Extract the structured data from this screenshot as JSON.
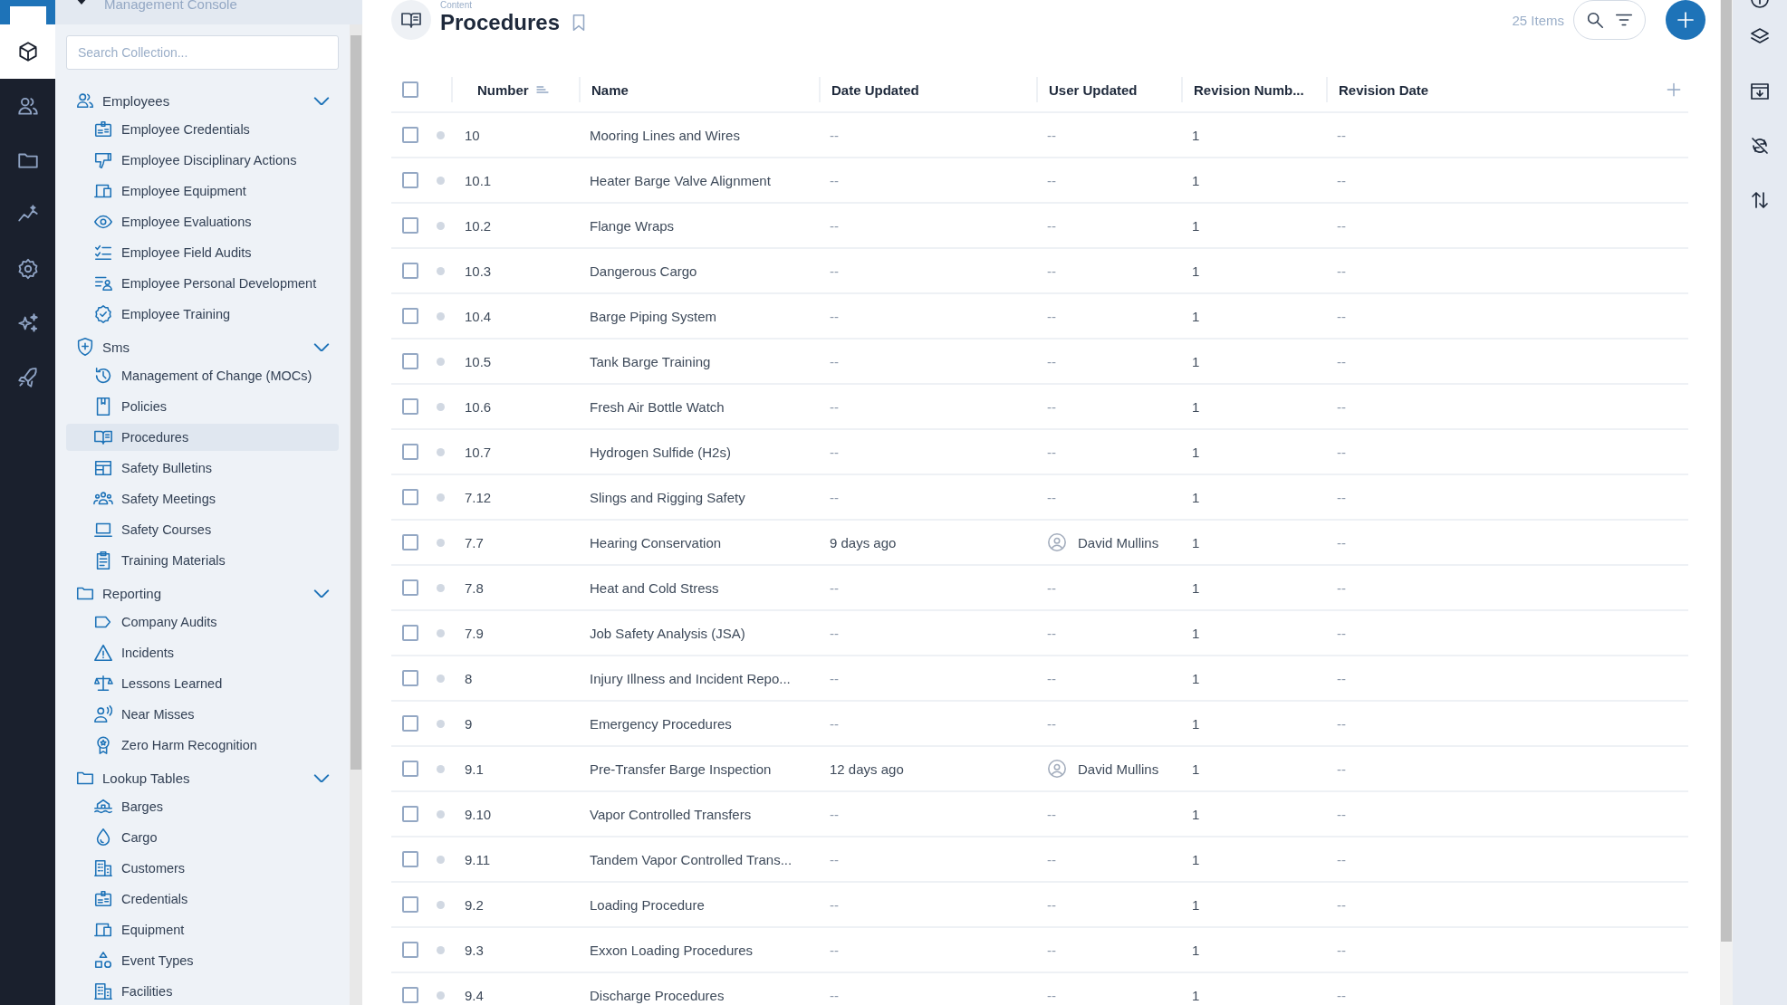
{
  "console": {
    "title": "Management Console"
  },
  "rail": [
    {
      "kind": "cube",
      "selected": true
    },
    {
      "kind": "users",
      "selected": false
    },
    {
      "kind": "folder",
      "selected": false
    },
    {
      "kind": "chart",
      "selected": false
    },
    {
      "kind": "gear",
      "selected": false
    },
    {
      "kind": "sparkles",
      "selected": false
    },
    {
      "kind": "rocket",
      "selected": false
    }
  ],
  "sidebar": {
    "search": {
      "placeholder": "Search Collection..."
    },
    "groups": [
      {
        "label": "Employees",
        "expanded": true,
        "children": [
          {
            "label": "Employee Credentials",
            "selected": false
          },
          {
            "label": "Employee Disciplinary Actions",
            "selected": false
          },
          {
            "label": "Employee Equipment",
            "selected": false
          },
          {
            "label": "Employee Evaluations",
            "selected": false
          },
          {
            "label": "Employee Field Audits",
            "selected": false
          },
          {
            "label": "Employee Personal Development",
            "selected": false
          },
          {
            "label": "Employee Training",
            "selected": false
          }
        ]
      },
      {
        "label": "Sms",
        "expanded": true,
        "children": [
          {
            "label": "Management of Change (MOCs)",
            "selected": false
          },
          {
            "label": "Policies",
            "selected": false
          },
          {
            "label": "Procedures",
            "selected": true
          },
          {
            "label": "Safety Bulletins",
            "selected": false
          },
          {
            "label": "Safety Meetings",
            "selected": false
          },
          {
            "label": "Safety Courses",
            "selected": false
          },
          {
            "label": "Training Materials",
            "selected": false
          }
        ]
      },
      {
        "label": "Reporting",
        "expanded": true,
        "children": [
          {
            "label": "Company Audits",
            "selected": false
          },
          {
            "label": "Incidents",
            "selected": false
          },
          {
            "label": "Lessons Learned",
            "selected": false
          },
          {
            "label": "Near Misses",
            "selected": false
          },
          {
            "label": "Zero Harm Recognition",
            "selected": false
          }
        ]
      },
      {
        "label": "Lookup Tables",
        "expanded": true,
        "children": [
          {
            "label": "Barges",
            "selected": false
          },
          {
            "label": "Cargo",
            "selected": false
          },
          {
            "label": "Customers",
            "selected": false
          },
          {
            "label": "Credentials",
            "selected": false
          },
          {
            "label": "Equipment",
            "selected": false
          },
          {
            "label": "Event Types",
            "selected": false
          },
          {
            "label": "Facilities",
            "selected": false
          }
        ]
      }
    ]
  },
  "header": {
    "breadcrumb": "Content",
    "title": "Procedures",
    "bookmarked": false,
    "item_count": "25 Items"
  },
  "table": {
    "all_checked": false,
    "columns": [
      {
        "label": "Number",
        "sorted": true
      },
      {
        "label": "Name",
        "sorted": false
      },
      {
        "label": "Date Updated",
        "sorted": false
      },
      {
        "label": "User Updated",
        "sorted": false
      },
      {
        "label": "Revision Numb...",
        "sorted": false
      },
      {
        "label": "Revision Date",
        "sorted": false
      }
    ],
    "rows": [
      {
        "checked": false,
        "number": "10",
        "name": "Mooring Lines and Wires",
        "date_updated": {
          "text": "--",
          "empty": true
        },
        "user_updated": {
          "text": "--",
          "avatar": false
        },
        "revision_number": "1",
        "revision_date": "--"
      },
      {
        "checked": false,
        "number": "10.1",
        "name": "Heater Barge Valve Alignment",
        "date_updated": {
          "text": "--",
          "empty": true
        },
        "user_updated": {
          "text": "--",
          "avatar": false
        },
        "revision_number": "1",
        "revision_date": "--"
      },
      {
        "checked": false,
        "number": "10.2",
        "name": "Flange Wraps",
        "date_updated": {
          "text": "--",
          "empty": true
        },
        "user_updated": {
          "text": "--",
          "avatar": false
        },
        "revision_number": "1",
        "revision_date": "--"
      },
      {
        "checked": false,
        "number": "10.3",
        "name": "Dangerous Cargo",
        "date_updated": {
          "text": "--",
          "empty": true
        },
        "user_updated": {
          "text": "--",
          "avatar": false
        },
        "revision_number": "1",
        "revision_date": "--"
      },
      {
        "checked": false,
        "number": "10.4",
        "name": "Barge Piping System",
        "date_updated": {
          "text": "--",
          "empty": true
        },
        "user_updated": {
          "text": "--",
          "avatar": false
        },
        "revision_number": "1",
        "revision_date": "--"
      },
      {
        "checked": false,
        "number": "10.5",
        "name": "Tank Barge Training",
        "date_updated": {
          "text": "--",
          "empty": true
        },
        "user_updated": {
          "text": "--",
          "avatar": false
        },
        "revision_number": "1",
        "revision_date": "--"
      },
      {
        "checked": false,
        "number": "10.6",
        "name": "Fresh Air Bottle Watch",
        "date_updated": {
          "text": "--",
          "empty": true
        },
        "user_updated": {
          "text": "--",
          "avatar": false
        },
        "revision_number": "1",
        "revision_date": "--"
      },
      {
        "checked": false,
        "number": "10.7",
        "name": "Hydrogen Sulfide (H2s)",
        "date_updated": {
          "text": "--",
          "empty": true
        },
        "user_updated": {
          "text": "--",
          "avatar": false
        },
        "revision_number": "1",
        "revision_date": "--"
      },
      {
        "checked": false,
        "number": "7.12",
        "name": "Slings and Rigging Safety",
        "date_updated": {
          "text": "--",
          "empty": true
        },
        "user_updated": {
          "text": "--",
          "avatar": false
        },
        "revision_number": "1",
        "revision_date": "--"
      },
      {
        "checked": false,
        "number": "7.7",
        "name": "Hearing Conservation",
        "date_updated": {
          "text": "9 days ago",
          "empty": false
        },
        "user_updated": {
          "text": "David Mullins",
          "avatar": true
        },
        "revision_number": "1",
        "revision_date": "--"
      },
      {
        "checked": false,
        "number": "7.8",
        "name": "Heat and Cold Stress",
        "date_updated": {
          "text": "--",
          "empty": true
        },
        "user_updated": {
          "text": "--",
          "avatar": false
        },
        "revision_number": "1",
        "revision_date": "--"
      },
      {
        "checked": false,
        "number": "7.9",
        "name": "Job Safety Analysis (JSA)",
        "date_updated": {
          "text": "--",
          "empty": true
        },
        "user_updated": {
          "text": "--",
          "avatar": false
        },
        "revision_number": "1",
        "revision_date": "--"
      },
      {
        "checked": false,
        "number": "8",
        "name": "Injury Illness and Incident Repo...",
        "date_updated": {
          "text": "--",
          "empty": true
        },
        "user_updated": {
          "text": "--",
          "avatar": false
        },
        "revision_number": "1",
        "revision_date": "--"
      },
      {
        "checked": false,
        "number": "9",
        "name": "Emergency Procedures",
        "date_updated": {
          "text": "--",
          "empty": true
        },
        "user_updated": {
          "text": "--",
          "avatar": false
        },
        "revision_number": "1",
        "revision_date": "--"
      },
      {
        "checked": false,
        "number": "9.1",
        "name": "Pre-Transfer Barge Inspection",
        "date_updated": {
          "text": "12 days ago",
          "empty": false
        },
        "user_updated": {
          "text": "David Mullins",
          "avatar": true
        },
        "revision_number": "1",
        "revision_date": "--"
      },
      {
        "checked": false,
        "number": "9.10",
        "name": "Vapor Controlled Transfers",
        "date_updated": {
          "text": "--",
          "empty": true
        },
        "user_updated": {
          "text": "--",
          "avatar": false
        },
        "revision_number": "1",
        "revision_date": "--"
      },
      {
        "checked": false,
        "number": "9.11",
        "name": "Tandem Vapor Controlled Trans...",
        "date_updated": {
          "text": "--",
          "empty": true
        },
        "user_updated": {
          "text": "--",
          "avatar": false
        },
        "revision_number": "1",
        "revision_date": "--"
      },
      {
        "checked": false,
        "number": "9.2",
        "name": "Loading Procedure",
        "date_updated": {
          "text": "--",
          "empty": true
        },
        "user_updated": {
          "text": "--",
          "avatar": false
        },
        "revision_number": "1",
        "revision_date": "--"
      },
      {
        "checked": false,
        "number": "9.3",
        "name": "Exxon Loading Procedures",
        "date_updated": {
          "text": "--",
          "empty": true
        },
        "user_updated": {
          "text": "--",
          "avatar": false
        },
        "revision_number": "1",
        "revision_date": "--"
      },
      {
        "checked": false,
        "number": "9.4",
        "name": "Discharge Procedures",
        "date_updated": {
          "text": "--",
          "empty": true
        },
        "user_updated": {
          "text": "--",
          "avatar": false
        },
        "revision_number": "1",
        "revision_date": "--"
      }
    ]
  },
  "right_rail": [
    {
      "kind": "info"
    },
    {
      "kind": "layers"
    },
    {
      "kind": "archive"
    },
    {
      "kind": "syncoff"
    },
    {
      "kind": "updown"
    }
  ]
}
